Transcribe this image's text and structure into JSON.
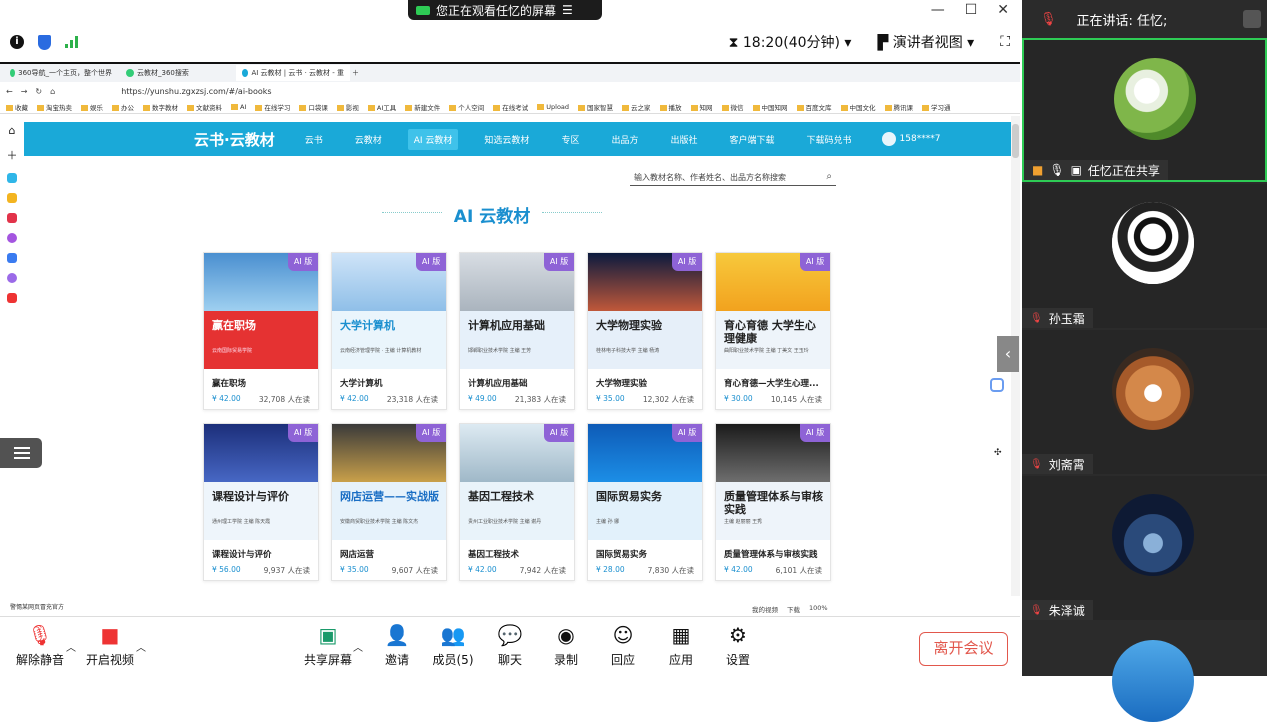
{
  "top_banner": {
    "label": "您正在观看任忆的屏幕"
  },
  "meeting_bar": {
    "time": "18:20(40分钟)",
    "view_mode": "演讲者视图"
  },
  "browser": {
    "tabs": [
      "360导航_一个主页，整个世界",
      "云教材_360搜索",
      "AI 云教材 | 云书 · 云教材 - 重"
    ],
    "url": "https://yunshu.zgxzsj.com/#/ai-books",
    "bookmarks": [
      "收藏",
      "淘宝热卖",
      "娱乐",
      "办公",
      "数字教材",
      "文献资料",
      "AI",
      "在线学习",
      "口袋课",
      "影视",
      "AI工具",
      "新建文件",
      "个人空间",
      "在线考试",
      "Upload",
      "国家智慧",
      "云之家",
      "播放",
      "知网",
      "微信",
      "中国知网",
      "百度文库",
      "中国文化",
      "腾讯课",
      "学习通"
    ],
    "status": [
      "我的视频",
      "下载",
      "100%"
    ],
    "bottom_note": "警惕某网页冒充官方"
  },
  "site": {
    "logo": "云书·云教材",
    "nav": [
      "云书",
      "云教材",
      "AI 云教材",
      "知选云教材",
      "专区",
      "出品方",
      "出版社",
      "客户端下载",
      "下载码兑书"
    ],
    "user": "158****7",
    "search_placeholder": "输入教材名称、作者姓名、出品方名称搜索",
    "page_title": "AI 云教材"
  },
  "books": [
    {
      "cover": "赢在职场",
      "sub": "云南国际贸易学院",
      "name": "赢在职场",
      "price": "¥ 42.00",
      "readers": "32,708 人在读",
      "style": "red"
    },
    {
      "cover": "大学计算机",
      "sub": "云南经济管理学院 · 主编 计算机教材",
      "name": "大学计算机",
      "price": "¥ 42.00",
      "readers": "23,318 人在读",
      "style": "blue"
    },
    {
      "cover": "计算机应用基础",
      "sub": "邯郸职业技术学院  主编 王芳",
      "name": "计算机应用基础",
      "price": "¥ 49.00",
      "readers": "21,383 人在读",
      "style": "grey"
    },
    {
      "cover": "大学物理实验",
      "sub": "桂林电子科技大学 主编 杨涛",
      "name": "大学物理实验",
      "price": "¥ 35.00",
      "readers": "12,302 人在读",
      "style": "space"
    },
    {
      "cover": "育心育德 大学生心理健康",
      "sub": "曲阳职业技术学院 主编 丁美文 王玉玲",
      "name": "育心育德—大学生心理...",
      "price": "¥ 30.00",
      "readers": "10,145 人在读",
      "style": "sun"
    },
    {
      "cover": "课程设计与评价",
      "sub": "通州理工学院  主编 陈天霞",
      "name": "课程设计与评价",
      "price": "¥ 56.00",
      "readers": "9,937 人在读",
      "style": "navy"
    },
    {
      "cover": "网店运营——实战版",
      "sub": "安徽商贸职业技术学院 主编 陈文杰",
      "name": "网店运营",
      "price": "¥ 35.00",
      "readers": "9,607 人在读",
      "style": "shop"
    },
    {
      "cover": "基因工程技术",
      "sub": "贵州工业职业技术学院 主编 谢丹",
      "name": "基因工程技术",
      "price": "¥ 42.00",
      "readers": "7,942 人在读",
      "style": "lab"
    },
    {
      "cover": "国际贸易实务",
      "sub": "主编 孙 娜",
      "name": "国际贸易实务",
      "price": "¥ 28.00",
      "readers": "7,830 人在读",
      "style": "city"
    },
    {
      "cover": "质量管理体系与审核实践",
      "sub": "主编 赵丽丽  王秀",
      "name": "质量管理体系与审核实践",
      "price": "¥ 42.00",
      "readers": "6,101 人在读",
      "style": "biz"
    }
  ],
  "ai_badge": "AI 版",
  "dock": {
    "mute": "解除静音",
    "video": "开启视频",
    "share": "共享屏幕",
    "invite": "邀请",
    "members": "成员(5)",
    "chat": "聊天",
    "record": "录制",
    "react": "回应",
    "apps": "应用",
    "settings": "设置",
    "leave": "离开会议"
  },
  "panel": {
    "speaking_label": "正在讲话:",
    "speaker": "任忆;",
    "participants": [
      {
        "name": "任忆正在共享"
      },
      {
        "name": "孙玉霜"
      },
      {
        "name": "刘斋霄"
      },
      {
        "name": "朱泽诚"
      }
    ]
  }
}
